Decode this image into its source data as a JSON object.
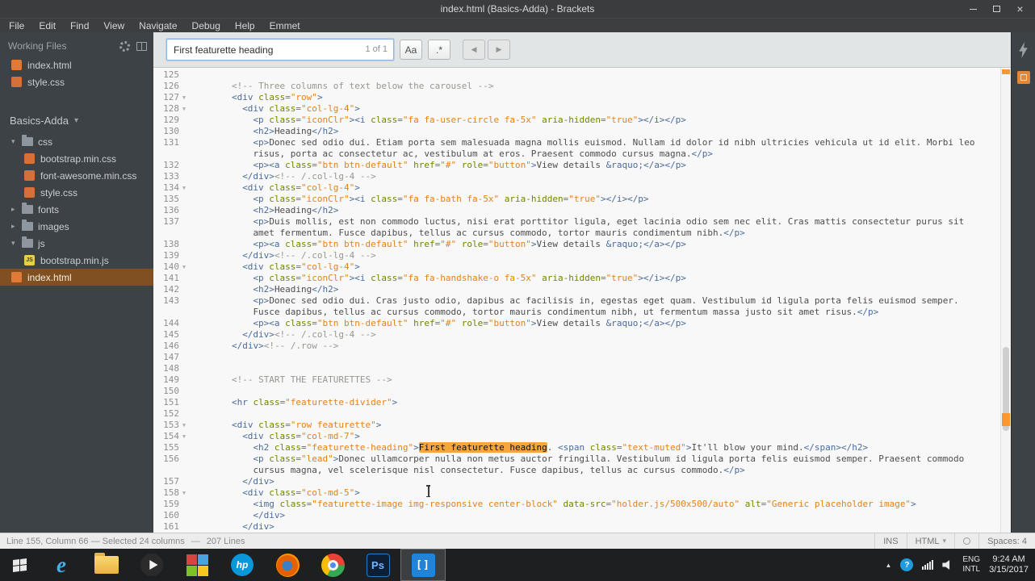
{
  "window": {
    "title": "index.html (Basics-Adda) - Brackets",
    "close_glyph": "×"
  },
  "menu": {
    "items": [
      "File",
      "Edit",
      "Find",
      "View",
      "Navigate",
      "Debug",
      "Help",
      "Emmet"
    ]
  },
  "glyphs": {
    "fold": "▼",
    "expanded": "▾",
    "collapsed": "▸"
  },
  "sidebar": {
    "working_files_label": "Working Files",
    "working_files": [
      {
        "name": "index.html",
        "kind": "html"
      },
      {
        "name": "style.css",
        "kind": "css"
      }
    ],
    "project_name": "Basics-Adda",
    "project_caret": "▾",
    "js_badge": "JS",
    "tree": [
      {
        "label": "css",
        "kind": "folder",
        "depth": 0,
        "expanded": true
      },
      {
        "label": "bootstrap.min.css",
        "kind": "css",
        "depth": 1
      },
      {
        "label": "font-awesome.min.css",
        "kind": "css",
        "depth": 1
      },
      {
        "label": "style.css",
        "kind": "css",
        "depth": 1
      },
      {
        "label": "fonts",
        "kind": "folder",
        "depth": 0,
        "expanded": false
      },
      {
        "label": "images",
        "kind": "folder",
        "depth": 0,
        "expanded": false
      },
      {
        "label": "js",
        "kind": "folder",
        "depth": 0,
        "expanded": true
      },
      {
        "label": "bootstrap.min.js",
        "kind": "js",
        "depth": 1
      },
      {
        "label": "index.html",
        "kind": "html",
        "depth": 0,
        "selected": true
      }
    ]
  },
  "search_bar": {
    "query": "First featurette heading",
    "match_count": "1 of 1",
    "case_button": "Aa",
    "regex_button": ".*",
    "prev": "◀",
    "next": "▶"
  },
  "editor": {
    "lines": [
      {
        "n": 125,
        "indent": 0,
        "tokens": []
      },
      {
        "n": 126,
        "indent": 8,
        "tokens": [
          [
            "c",
            "<!-- Three columns of text below the carousel -->"
          ]
        ]
      },
      {
        "n": 127,
        "indent": 8,
        "fold": true,
        "tokens": [
          [
            "t",
            "<div"
          ],
          [
            "a",
            " class="
          ],
          [
            "s",
            "\"row\""
          ],
          [
            "t",
            ">"
          ]
        ]
      },
      {
        "n": 128,
        "indent": 10,
        "fold": true,
        "tokens": [
          [
            "t",
            "<div"
          ],
          [
            "a",
            " class="
          ],
          [
            "s",
            "\"col-lg-4\""
          ],
          [
            "t",
            ">"
          ]
        ]
      },
      {
        "n": 129,
        "indent": 12,
        "tokens": [
          [
            "t",
            "<p"
          ],
          [
            "a",
            " class="
          ],
          [
            "s",
            "\"iconClr\""
          ],
          [
            "t",
            "><i"
          ],
          [
            "a",
            " class="
          ],
          [
            "s",
            "\"fa fa-user-circle fa-5x\""
          ],
          [
            "a",
            " aria-hidden="
          ],
          [
            "s",
            "\"true\""
          ],
          [
            "t",
            "></i></p>"
          ]
        ]
      },
      {
        "n": 130,
        "indent": 12,
        "tokens": [
          [
            "t",
            "<h2>"
          ],
          [
            "x",
            "Heading"
          ],
          [
            "t",
            "</h2>"
          ]
        ]
      },
      {
        "n": 131,
        "indent": 12,
        "tokens": [
          [
            "t",
            "<p>"
          ],
          [
            "x",
            "Donec sed odio dui. Etiam porta sem malesuada magna mollis euismod. Nullam id dolor id nibh ultricies vehicula ut id elit. Morbi leo risus, porta ac consectetur ac, vestibulum at eros. Praesent commodo cursus magna."
          ],
          [
            "t",
            "</p>"
          ]
        ]
      },
      {
        "n": 132,
        "indent": 12,
        "tokens": [
          [
            "t",
            "<p><a"
          ],
          [
            "a",
            " class="
          ],
          [
            "s",
            "\"btn btn-default\""
          ],
          [
            "a",
            " href="
          ],
          [
            "s",
            "\"#\""
          ],
          [
            "a",
            " role="
          ],
          [
            "s",
            "\"button\""
          ],
          [
            "t",
            ">"
          ],
          [
            "x",
            "View details "
          ],
          [
            "e",
            "&raquo;"
          ],
          [
            "t",
            "</a></p>"
          ]
        ]
      },
      {
        "n": 133,
        "indent": 10,
        "tokens": [
          [
            "t",
            "</div>"
          ],
          [
            "c",
            "<!-- /.col-lg-4 -->"
          ]
        ]
      },
      {
        "n": 134,
        "indent": 10,
        "fold": true,
        "tokens": [
          [
            "t",
            "<div"
          ],
          [
            "a",
            " class="
          ],
          [
            "s",
            "\"col-lg-4\""
          ],
          [
            "t",
            ">"
          ]
        ]
      },
      {
        "n": 135,
        "indent": 12,
        "tokens": [
          [
            "t",
            "<p"
          ],
          [
            "a",
            " class="
          ],
          [
            "s",
            "\"iconClr\""
          ],
          [
            "t",
            "><i"
          ],
          [
            "a",
            " class="
          ],
          [
            "s",
            "\"fa fa-bath fa-5x\""
          ],
          [
            "a",
            " aria-hidden="
          ],
          [
            "s",
            "\"true\""
          ],
          [
            "t",
            "></i></p>"
          ]
        ]
      },
      {
        "n": 136,
        "indent": 12,
        "tokens": [
          [
            "t",
            "<h2>"
          ],
          [
            "x",
            "Heading"
          ],
          [
            "t",
            "</h2>"
          ]
        ]
      },
      {
        "n": 137,
        "indent": 12,
        "tokens": [
          [
            "t",
            "<p>"
          ],
          [
            "x",
            "Duis mollis, est non commodo luctus, nisi erat porttitor ligula, eget lacinia odio sem nec elit. Cras mattis consectetur purus sit amet fermentum. Fusce dapibus, tellus ac cursus commodo, tortor mauris condimentum nibh."
          ],
          [
            "t",
            "</p>"
          ]
        ]
      },
      {
        "n": 138,
        "indent": 12,
        "tokens": [
          [
            "t",
            "<p><a"
          ],
          [
            "a",
            " class="
          ],
          [
            "s",
            "\"btn btn-default\""
          ],
          [
            "a",
            " href="
          ],
          [
            "s",
            "\"#\""
          ],
          [
            "a",
            " role="
          ],
          [
            "s",
            "\"button\""
          ],
          [
            "t",
            ">"
          ],
          [
            "x",
            "View details "
          ],
          [
            "e",
            "&raquo;"
          ],
          [
            "t",
            "</a></p>"
          ]
        ]
      },
      {
        "n": 139,
        "indent": 10,
        "tokens": [
          [
            "t",
            "</div>"
          ],
          [
            "c",
            "<!-- /.col-lg-4 -->"
          ]
        ]
      },
      {
        "n": 140,
        "indent": 10,
        "fold": true,
        "tokens": [
          [
            "t",
            "<div"
          ],
          [
            "a",
            " class="
          ],
          [
            "s",
            "\"col-lg-4\""
          ],
          [
            "t",
            ">"
          ]
        ]
      },
      {
        "n": 141,
        "indent": 12,
        "tokens": [
          [
            "t",
            "<p"
          ],
          [
            "a",
            " class="
          ],
          [
            "s",
            "\"iconClr\""
          ],
          [
            "t",
            "><i"
          ],
          [
            "a",
            " class="
          ],
          [
            "s",
            "\"fa fa-handshake-o fa-5x\""
          ],
          [
            "a",
            " aria-hidden="
          ],
          [
            "s",
            "\"true\""
          ],
          [
            "t",
            "></i></p>"
          ]
        ]
      },
      {
        "n": 142,
        "indent": 12,
        "tokens": [
          [
            "t",
            "<h2>"
          ],
          [
            "x",
            "Heading"
          ],
          [
            "t",
            "</h2>"
          ]
        ]
      },
      {
        "n": 143,
        "indent": 12,
        "tokens": [
          [
            "t",
            "<p>"
          ],
          [
            "x",
            "Donec sed odio dui. Cras justo odio, dapibus ac facilisis in, egestas eget quam. Vestibulum id ligula porta felis euismod semper. Fusce dapibus, tellus ac cursus commodo, tortor mauris condimentum nibh, ut fermentum massa justo sit amet risus."
          ],
          [
            "t",
            "</p>"
          ]
        ]
      },
      {
        "n": 144,
        "indent": 12,
        "tokens": [
          [
            "t",
            "<p><a"
          ],
          [
            "a",
            " class="
          ],
          [
            "s",
            "\"btn btn-default\""
          ],
          [
            "a",
            " href="
          ],
          [
            "s",
            "\"#\""
          ],
          [
            "a",
            " role="
          ],
          [
            "s",
            "\"button\""
          ],
          [
            "t",
            ">"
          ],
          [
            "x",
            "View details "
          ],
          [
            "e",
            "&raquo;"
          ],
          [
            "t",
            "</a></p>"
          ]
        ]
      },
      {
        "n": 145,
        "indent": 10,
        "tokens": [
          [
            "t",
            "</div>"
          ],
          [
            "c",
            "<!-- /.col-lg-4 -->"
          ]
        ]
      },
      {
        "n": 146,
        "indent": 8,
        "tokens": [
          [
            "t",
            "</div>"
          ],
          [
            "c",
            "<!-- /.row -->"
          ]
        ]
      },
      {
        "n": 147,
        "indent": 0,
        "tokens": []
      },
      {
        "n": 148,
        "indent": 0,
        "tokens": []
      },
      {
        "n": 149,
        "indent": 8,
        "tokens": [
          [
            "c",
            "<!-- START THE FEATURETTES -->"
          ]
        ]
      },
      {
        "n": 150,
        "indent": 0,
        "tokens": []
      },
      {
        "n": 151,
        "indent": 8,
        "tokens": [
          [
            "t",
            "<hr"
          ],
          [
            "a",
            " class="
          ],
          [
            "s",
            "\"featurette-divider\""
          ],
          [
            "t",
            ">"
          ]
        ]
      },
      {
        "n": 152,
        "indent": 0,
        "tokens": []
      },
      {
        "n": 153,
        "indent": 8,
        "fold": true,
        "tokens": [
          [
            "t",
            "<div"
          ],
          [
            "a",
            " class="
          ],
          [
            "s",
            "\"row featurette\""
          ],
          [
            "t",
            ">"
          ]
        ]
      },
      {
        "n": 154,
        "indent": 10,
        "fold": true,
        "tokens": [
          [
            "t",
            "<div"
          ],
          [
            "a",
            " class="
          ],
          [
            "s",
            "\"col-md-7\""
          ],
          [
            "t",
            ">"
          ]
        ]
      },
      {
        "n": 155,
        "indent": 12,
        "tokens": [
          [
            "t",
            "<h2"
          ],
          [
            "a",
            " class="
          ],
          [
            "s",
            "\"featurette-heading\""
          ],
          [
            "t",
            ">"
          ],
          [
            "h",
            "First featurette heading"
          ],
          [
            "x",
            ". "
          ],
          [
            "t",
            "<span"
          ],
          [
            "a",
            " class="
          ],
          [
            "s",
            "\"text-muted\""
          ],
          [
            "t",
            ">"
          ],
          [
            "x",
            "It'll blow your mind."
          ],
          [
            "t",
            "</span></h2>"
          ]
        ]
      },
      {
        "n": 156,
        "indent": 12,
        "tokens": [
          [
            "t",
            "<p"
          ],
          [
            "a",
            " class="
          ],
          [
            "s",
            "\"lead\""
          ],
          [
            "t",
            ">"
          ],
          [
            "x",
            "Donec ullamcorper nulla non metus auctor fringilla. Vestibulum id ligula porta felis euismod semper. Praesent commodo cursus magna, vel scelerisque nisl consectetur. Fusce dapibus, tellus ac cursus commodo."
          ],
          [
            "t",
            "</p>"
          ]
        ]
      },
      {
        "n": 157,
        "indent": 10,
        "tokens": [
          [
            "t",
            "</div>"
          ]
        ]
      },
      {
        "n": 158,
        "indent": 10,
        "fold": true,
        "tokens": [
          [
            "t",
            "<div"
          ],
          [
            "a",
            " class="
          ],
          [
            "s",
            "\"col-md-5\""
          ],
          [
            "t",
            ">"
          ]
        ]
      },
      {
        "n": 159,
        "indent": 12,
        "tokens": [
          [
            "t",
            "<img"
          ],
          [
            "a",
            " class="
          ],
          [
            "s",
            "\"featurette-image img-responsive center-block\""
          ],
          [
            "a",
            " data-src="
          ],
          [
            "s",
            "\"holder.js/500x500/auto\""
          ],
          [
            "a",
            " alt="
          ],
          [
            "s",
            "\"Generic placeholder image\""
          ],
          [
            "t",
            ">"
          ]
        ]
      },
      {
        "n": 160,
        "indent": 12,
        "tokens": [
          [
            "t",
            "</div>"
          ]
        ]
      },
      {
        "n": 161,
        "indent": 10,
        "tokens": [
          [
            "t",
            "</div>"
          ]
        ]
      }
    ]
  },
  "status_bar": {
    "cursor_info": "Line 155, Column 66 — Selected 24 columns",
    "line_count": "207 Lines",
    "overwrite": "INS",
    "language": "HTML",
    "language_caret": "▾",
    "spaces": "Spaces: 4"
  },
  "taskbar": {
    "apps": [
      {
        "name": "start-button",
        "kind": "start"
      },
      {
        "name": "internet-explorer-icon",
        "kind": "ie",
        "label": "e"
      },
      {
        "name": "file-explorer-icon",
        "kind": "folder"
      },
      {
        "name": "media-player-icon",
        "kind": "media"
      },
      {
        "name": "photos-app-icon",
        "kind": "photos"
      },
      {
        "name": "hp-support-icon",
        "kind": "hp",
        "label": "hp"
      },
      {
        "name": "firefox-icon",
        "kind": "firefox"
      },
      {
        "name": "chrome-icon",
        "kind": "chrome"
      },
      {
        "name": "photoshop-icon",
        "kind": "ps",
        "label": "Ps"
      },
      {
        "name": "brackets-taskbar-icon",
        "kind": "brackets",
        "label": "[]",
        "active": true
      }
    ],
    "tray": {
      "caret": "▲",
      "help_label": "?",
      "lang_top": "ENG",
      "lang_bottom": "INTL",
      "time": "9:24 AM",
      "date": "3/15/2017"
    }
  }
}
